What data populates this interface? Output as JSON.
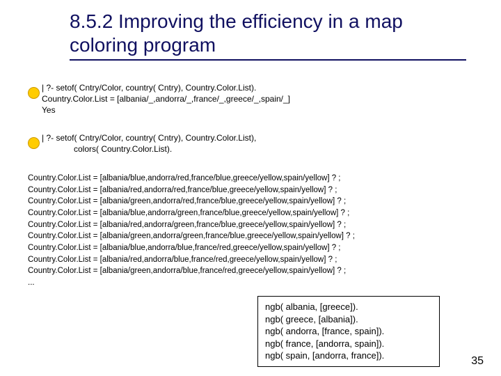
{
  "title": "8.5.2 Improving the efficiency in a map coloring program",
  "query1": {
    "line1": "| ?- setof( Cntry/Color, country( Cntry), Country.Color.List).",
    "line2": "Country.Color.List = [albania/_,andorra/_,france/_,greece/_,spain/_]",
    "line3": "Yes"
  },
  "query2": {
    "line1": "| ?- setof( Cntry/Color, country( Cntry), Country.Color.List),",
    "line2": "colors( Country.Color.List)."
  },
  "results": [
    "Country.Color.List = [albania/blue,andorra/red,france/blue,greece/yellow,spain/yellow] ? ;",
    "Country.Color.List = [albania/red,andorra/red,france/blue,greece/yellow,spain/yellow] ? ;",
    "Country.Color.List = [albania/green,andorra/red,france/blue,greece/yellow,spain/yellow] ? ;",
    "Country.Color.List = [albania/blue,andorra/green,france/blue,greece/yellow,spain/yellow] ? ;",
    "Country.Color.List = [albania/red,andorra/green,france/blue,greece/yellow,spain/yellow] ? ;",
    "Country.Color.List = [albania/green,andorra/green,france/blue,greece/yellow,spain/yellow] ? ;",
    "Country.Color.List = [albania/blue,andorra/blue,france/red,greece/yellow,spain/yellow] ? ;",
    "Country.Color.List = [albania/red,andorra/blue,france/red,greece/yellow,spain/yellow] ? ;",
    "Country.Color.List = [albania/green,andorra/blue,france/red,greece/yellow,spain/yellow] ? ;",
    "..."
  ],
  "ngb": [
    "ngb( albania, [greece]).",
    "ngb( greece, [albania]).",
    "ngb( andorra, [france, spain]).",
    "ngb( france, [andorra, spain]).",
    "ngb( spain,  [andorra, france])."
  ],
  "pagenum": "35"
}
